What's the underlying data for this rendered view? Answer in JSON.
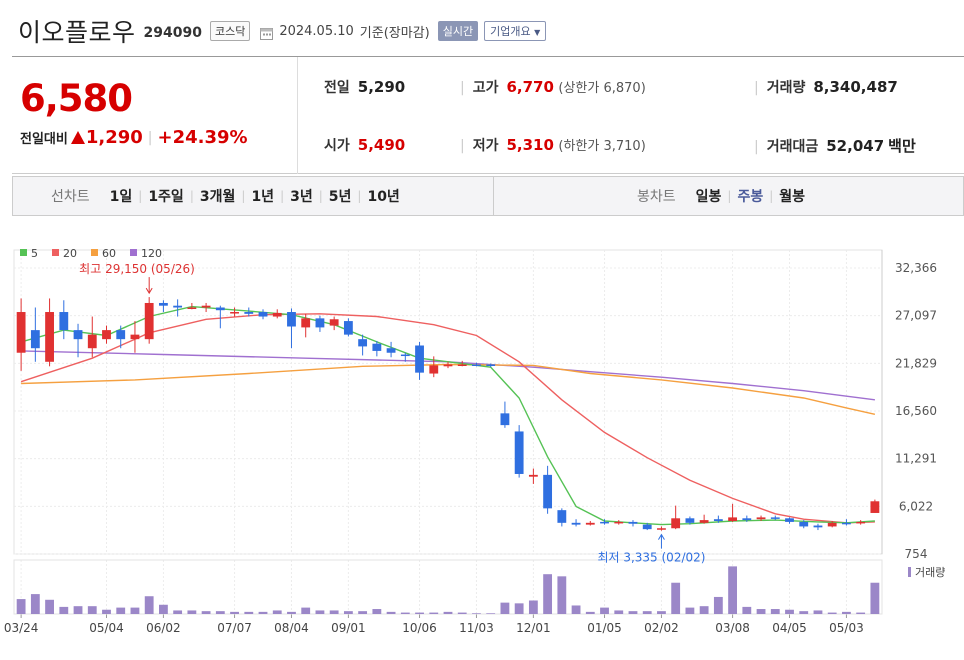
{
  "header": {
    "name": "이오플로우",
    "code": "294090",
    "market": "코스닥",
    "date": "2024.05.10",
    "basis": "기준(장마감)",
    "realtime": "실시간",
    "company_info": "기업개요"
  },
  "quote": {
    "price": "6,580",
    "change_label": "전일대비",
    "change_abs": "1,290",
    "change_pct": "+24.39%",
    "prev_label": "전일",
    "prev": "5,290",
    "open_label": "시가",
    "open": "5,490",
    "high_label": "고가",
    "high": "6,770",
    "upper_limit": "(상한가 6,870)",
    "low_label": "저가",
    "low": "5,310",
    "lower_limit": "(하한가 3,710)",
    "volume_label": "거래량",
    "volume": "8,340,487",
    "amount_label": "거래대금",
    "amount": "52,047",
    "amount_unit": "백만"
  },
  "tabs": {
    "line_group": "선차트",
    "line_tabs": [
      "1일",
      "1주일",
      "3개월",
      "1년",
      "3년",
      "5년",
      "10년"
    ],
    "candle_group": "봉차트",
    "candle_tabs": [
      "일봉",
      "주봉",
      "월봉"
    ],
    "active_candle": "주봉"
  },
  "colors": {
    "up": "#e03131",
    "down": "#2f6fe0",
    "ma5": "#55c255",
    "ma20": "#ee6060",
    "ma60": "#f5a040",
    "ma120": "#a070d0",
    "volume": "#9b87c8"
  },
  "chart_data": {
    "type": "candlestick",
    "title": "",
    "y_ticks": [
      32366,
      27097,
      21829,
      16560,
      11291,
      6022,
      754
    ],
    "y_tick_labels": [
      "32,366",
      "27,097",
      "21,829",
      "16,560",
      "11,291",
      "6,022",
      "754"
    ],
    "ylim": [
      754,
      32366
    ],
    "x_ticks": [
      {
        "label": "03/24",
        "index": 0
      },
      {
        "label": "05/04",
        "index": 6
      },
      {
        "label": "06/02",
        "index": 10
      },
      {
        "label": "07/07",
        "index": 15
      },
      {
        "label": "08/04",
        "index": 19
      },
      {
        "label": "09/01",
        "index": 23
      },
      {
        "label": "10/06",
        "index": 28
      },
      {
        "label": "11/03",
        "index": 32
      },
      {
        "label": "12/01",
        "index": 36
      },
      {
        "label": "01/05",
        "index": 41
      },
      {
        "label": "02/02",
        "index": 45
      },
      {
        "label": "03/08",
        "index": 50
      },
      {
        "label": "04/05",
        "index": 54
      },
      {
        "label": "05/03",
        "index": 58
      }
    ],
    "legend": [
      {
        "name": "5",
        "color": "#55c255"
      },
      {
        "name": "20",
        "color": "#ee6060"
      },
      {
        "name": "60",
        "color": "#f5a040"
      },
      {
        "name": "120",
        "color": "#a070d0"
      }
    ],
    "annotations": {
      "high": {
        "text": "최고 29,150 (05/26)",
        "index": 9,
        "value": 29150
      },
      "low": {
        "text": "최저 3,335 (02/02)",
        "index": 45,
        "value": 3335
      }
    },
    "volume_label": "거래량",
    "candles": [
      [
        23000,
        27500,
        29000,
        21000
      ],
      [
        25500,
        23500,
        28000,
        22000
      ],
      [
        22000,
        27500,
        29000,
        21500
      ],
      [
        27500,
        25500,
        28800,
        24500
      ],
      [
        25500,
        24500,
        26200,
        22500
      ],
      [
        23500,
        25000,
        27000,
        22500
      ],
      [
        24500,
        25500,
        26000,
        24000
      ],
      [
        25500,
        24500,
        26000,
        23500
      ],
      [
        24500,
        25000,
        26500,
        23000
      ],
      [
        24500,
        28500,
        29150,
        24000
      ],
      [
        28500,
        28200,
        28800,
        27500
      ],
      [
        28200,
        28000,
        28900,
        27000
      ],
      [
        28000,
        28000,
        28500,
        27800
      ],
      [
        28000,
        28200,
        28500,
        27500
      ],
      [
        28000,
        27700,
        28200,
        25700
      ],
      [
        27500,
        27500,
        28000,
        27000
      ],
      [
        27500,
        27300,
        28000,
        27000
      ],
      [
        27500,
        27000,
        27800,
        26700
      ],
      [
        27000,
        27400,
        27800,
        26800
      ],
      [
        27500,
        25900,
        27900,
        23500
      ],
      [
        25800,
        26800,
        27300,
        24700
      ],
      [
        26800,
        25800,
        27100,
        25300
      ],
      [
        26000,
        26700,
        27000,
        25500
      ],
      [
        26500,
        25000,
        26800,
        24800
      ],
      [
        24500,
        23700,
        25000,
        22700
      ],
      [
        24000,
        23200,
        24300,
        22600
      ],
      [
        23500,
        23000,
        24200,
        22500
      ],
      [
        22800,
        22700,
        23000,
        22000
      ],
      [
        23800,
        20800,
        24200,
        20000
      ],
      [
        20700,
        21600,
        22600,
        20300
      ],
      [
        21500,
        21700,
        22000,
        21300
      ],
      [
        21700,
        21700,
        22100,
        21500
      ],
      [
        21700,
        21650,
        21900,
        21500
      ],
      [
        21700,
        21600,
        21800,
        21400
      ],
      [
        16300,
        15000,
        17600,
        14700
      ],
      [
        14300,
        9600,
        15000,
        9200
      ],
      [
        9300,
        9500,
        10200,
        8500
      ],
      [
        9500,
        5800,
        10500,
        5200
      ],
      [
        5600,
        4200,
        5800,
        3800
      ],
      [
        4200,
        4000,
        4600,
        3800
      ],
      [
        4000,
        4200,
        4400,
        3900
      ],
      [
        4300,
        4200,
        4600,
        4000
      ],
      [
        4200,
        4300,
        4500,
        4000
      ],
      [
        4300,
        4100,
        4500,
        3800
      ],
      [
        4000,
        3500,
        4200,
        3400
      ],
      [
        3600,
        3600,
        3800,
        3335
      ],
      [
        3600,
        4700,
        6100,
        3500
      ],
      [
        4700,
        4200,
        4900,
        4000
      ],
      [
        4200,
        4500,
        5100,
        4100
      ],
      [
        4600,
        4400,
        5000,
        4200
      ],
      [
        4400,
        4800,
        6300,
        4300
      ],
      [
        4700,
        4500,
        5000,
        4300
      ],
      [
        4600,
        4800,
        5000,
        4400
      ],
      [
        4800,
        4700,
        5000,
        4500
      ],
      [
        4700,
        4300,
        4800,
        4100
      ],
      [
        4300,
        3800,
        4500,
        3600
      ],
      [
        3900,
        3700,
        4100,
        3400
      ],
      [
        3800,
        4200,
        4400,
        3700
      ],
      [
        4200,
        4100,
        4600,
        3900
      ],
      [
        4200,
        4300,
        4500,
        4000
      ],
      [
        5290,
        6580,
        6770,
        5310
      ]
    ],
    "volumes": [
      2.1,
      2.8,
      2.0,
      1.0,
      1.1,
      1.1,
      0.6,
      0.9,
      0.9,
      2.5,
      1.3,
      0.5,
      0.5,
      0.4,
      0.4,
      0.3,
      0.3,
      0.3,
      0.5,
      0.3,
      0.9,
      0.5,
      0.5,
      0.4,
      0.4,
      0.7,
      0.3,
      0.2,
      0.2,
      0.2,
      0.3,
      0.2,
      0.1,
      0.1,
      1.6,
      1.5,
      1.9,
      5.6,
      5.3,
      1.2,
      0.3,
      0.9,
      0.5,
      0.4,
      0.4,
      0.4,
      4.4,
      0.9,
      1.1,
      2.4,
      6.7,
      1.0,
      0.7,
      0.7,
      0.6,
      0.4,
      0.5,
      0.2,
      0.3,
      0.2,
      4.4
    ],
    "ma": {
      "5": [
        [
          0,
          24200
        ],
        [
          3,
          25500
        ],
        [
          6,
          24900
        ],
        [
          9,
          27000
        ],
        [
          12,
          28100
        ],
        [
          16,
          27600
        ],
        [
          19,
          27200
        ],
        [
          22,
          26100
        ],
        [
          25,
          24200
        ],
        [
          28,
          22400
        ],
        [
          31,
          21800
        ],
        [
          33,
          21400
        ],
        [
          35,
          18000
        ],
        [
          37,
          11500
        ],
        [
          39,
          6000
        ],
        [
          41,
          4400
        ],
        [
          43,
          4200
        ],
        [
          45,
          4000
        ],
        [
          47,
          4100
        ],
        [
          50,
          4400
        ],
        [
          53,
          4500
        ],
        [
          56,
          4300
        ],
        [
          58,
          4200
        ],
        [
          60,
          4400
        ]
      ],
      "20": [
        [
          0,
          19800
        ],
        [
          5,
          22400
        ],
        [
          9,
          25200
        ],
        [
          13,
          26700
        ],
        [
          17,
          27200
        ],
        [
          21,
          27300
        ],
        [
          25,
          27000
        ],
        [
          29,
          26100
        ],
        [
          32,
          24900
        ],
        [
          35,
          22000
        ],
        [
          38,
          17800
        ],
        [
          41,
          14200
        ],
        [
          44,
          11400
        ],
        [
          47,
          8900
        ],
        [
          50,
          6900
        ],
        [
          53,
          5200
        ],
        [
          55,
          4600
        ],
        [
          58,
          4200
        ],
        [
          60,
          4300
        ]
      ],
      "60": [
        [
          0,
          19600
        ],
        [
          8,
          20000
        ],
        [
          16,
          20700
        ],
        [
          24,
          21500
        ],
        [
          30,
          21700
        ],
        [
          36,
          21600
        ],
        [
          40,
          20700
        ],
        [
          45,
          20000
        ],
        [
          50,
          19100
        ],
        [
          55,
          18000
        ],
        [
          58,
          16900
        ],
        [
          60,
          16200
        ]
      ],
      "120": [
        [
          0,
          23200
        ],
        [
          10,
          22800
        ],
        [
          20,
          22400
        ],
        [
          30,
          22000
        ],
        [
          36,
          21400
        ],
        [
          40,
          20900
        ],
        [
          45,
          20300
        ],
        [
          50,
          19600
        ],
        [
          55,
          18800
        ],
        [
          60,
          17800
        ]
      ]
    }
  }
}
